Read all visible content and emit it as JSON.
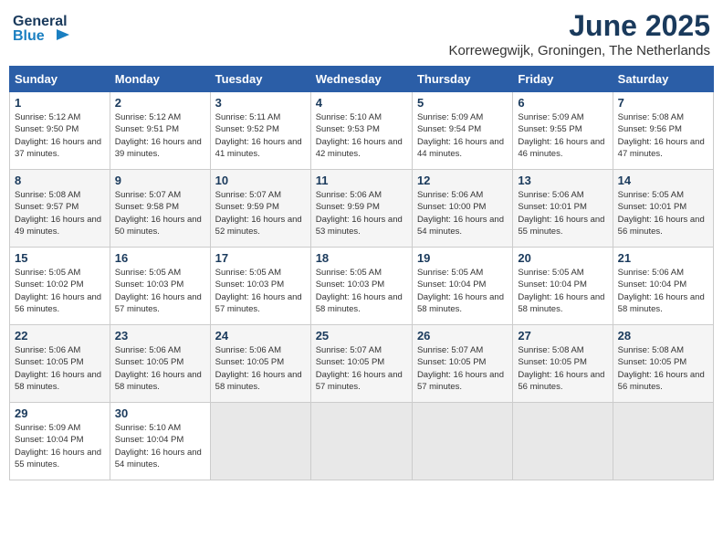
{
  "header": {
    "logo_line1": "General",
    "logo_line2": "Blue",
    "month": "June 2025",
    "location": "Korrewegwijk, Groningen, The Netherlands"
  },
  "weekdays": [
    "Sunday",
    "Monday",
    "Tuesday",
    "Wednesday",
    "Thursday",
    "Friday",
    "Saturday"
  ],
  "weeks": [
    [
      {
        "day": "1",
        "sunrise": "Sunrise: 5:12 AM",
        "sunset": "Sunset: 9:50 PM",
        "daylight": "Daylight: 16 hours and 37 minutes."
      },
      {
        "day": "2",
        "sunrise": "Sunrise: 5:12 AM",
        "sunset": "Sunset: 9:51 PM",
        "daylight": "Daylight: 16 hours and 39 minutes."
      },
      {
        "day": "3",
        "sunrise": "Sunrise: 5:11 AM",
        "sunset": "Sunset: 9:52 PM",
        "daylight": "Daylight: 16 hours and 41 minutes."
      },
      {
        "day": "4",
        "sunrise": "Sunrise: 5:10 AM",
        "sunset": "Sunset: 9:53 PM",
        "daylight": "Daylight: 16 hours and 42 minutes."
      },
      {
        "day": "5",
        "sunrise": "Sunrise: 5:09 AM",
        "sunset": "Sunset: 9:54 PM",
        "daylight": "Daylight: 16 hours and 44 minutes."
      },
      {
        "day": "6",
        "sunrise": "Sunrise: 5:09 AM",
        "sunset": "Sunset: 9:55 PM",
        "daylight": "Daylight: 16 hours and 46 minutes."
      },
      {
        "day": "7",
        "sunrise": "Sunrise: 5:08 AM",
        "sunset": "Sunset: 9:56 PM",
        "daylight": "Daylight: 16 hours and 47 minutes."
      }
    ],
    [
      {
        "day": "8",
        "sunrise": "Sunrise: 5:08 AM",
        "sunset": "Sunset: 9:57 PM",
        "daylight": "Daylight: 16 hours and 49 minutes."
      },
      {
        "day": "9",
        "sunrise": "Sunrise: 5:07 AM",
        "sunset": "Sunset: 9:58 PM",
        "daylight": "Daylight: 16 hours and 50 minutes."
      },
      {
        "day": "10",
        "sunrise": "Sunrise: 5:07 AM",
        "sunset": "Sunset: 9:59 PM",
        "daylight": "Daylight: 16 hours and 52 minutes."
      },
      {
        "day": "11",
        "sunrise": "Sunrise: 5:06 AM",
        "sunset": "Sunset: 9:59 PM",
        "daylight": "Daylight: 16 hours and 53 minutes."
      },
      {
        "day": "12",
        "sunrise": "Sunrise: 5:06 AM",
        "sunset": "Sunset: 10:00 PM",
        "daylight": "Daylight: 16 hours and 54 minutes."
      },
      {
        "day": "13",
        "sunrise": "Sunrise: 5:06 AM",
        "sunset": "Sunset: 10:01 PM",
        "daylight": "Daylight: 16 hours and 55 minutes."
      },
      {
        "day": "14",
        "sunrise": "Sunrise: 5:05 AM",
        "sunset": "Sunset: 10:01 PM",
        "daylight": "Daylight: 16 hours and 56 minutes."
      }
    ],
    [
      {
        "day": "15",
        "sunrise": "Sunrise: 5:05 AM",
        "sunset": "Sunset: 10:02 PM",
        "daylight": "Daylight: 16 hours and 56 minutes."
      },
      {
        "day": "16",
        "sunrise": "Sunrise: 5:05 AM",
        "sunset": "Sunset: 10:03 PM",
        "daylight": "Daylight: 16 hours and 57 minutes."
      },
      {
        "day": "17",
        "sunrise": "Sunrise: 5:05 AM",
        "sunset": "Sunset: 10:03 PM",
        "daylight": "Daylight: 16 hours and 57 minutes."
      },
      {
        "day": "18",
        "sunrise": "Sunrise: 5:05 AM",
        "sunset": "Sunset: 10:03 PM",
        "daylight": "Daylight: 16 hours and 58 minutes."
      },
      {
        "day": "19",
        "sunrise": "Sunrise: 5:05 AM",
        "sunset": "Sunset: 10:04 PM",
        "daylight": "Daylight: 16 hours and 58 minutes."
      },
      {
        "day": "20",
        "sunrise": "Sunrise: 5:05 AM",
        "sunset": "Sunset: 10:04 PM",
        "daylight": "Daylight: 16 hours and 58 minutes."
      },
      {
        "day": "21",
        "sunrise": "Sunrise: 5:06 AM",
        "sunset": "Sunset: 10:04 PM",
        "daylight": "Daylight: 16 hours and 58 minutes."
      }
    ],
    [
      {
        "day": "22",
        "sunrise": "Sunrise: 5:06 AM",
        "sunset": "Sunset: 10:05 PM",
        "daylight": "Daylight: 16 hours and 58 minutes."
      },
      {
        "day": "23",
        "sunrise": "Sunrise: 5:06 AM",
        "sunset": "Sunset: 10:05 PM",
        "daylight": "Daylight: 16 hours and 58 minutes."
      },
      {
        "day": "24",
        "sunrise": "Sunrise: 5:06 AM",
        "sunset": "Sunset: 10:05 PM",
        "daylight": "Daylight: 16 hours and 58 minutes."
      },
      {
        "day": "25",
        "sunrise": "Sunrise: 5:07 AM",
        "sunset": "Sunset: 10:05 PM",
        "daylight": "Daylight: 16 hours and 57 minutes."
      },
      {
        "day": "26",
        "sunrise": "Sunrise: 5:07 AM",
        "sunset": "Sunset: 10:05 PM",
        "daylight": "Daylight: 16 hours and 57 minutes."
      },
      {
        "day": "27",
        "sunrise": "Sunrise: 5:08 AM",
        "sunset": "Sunset: 10:05 PM",
        "daylight": "Daylight: 16 hours and 56 minutes."
      },
      {
        "day": "28",
        "sunrise": "Sunrise: 5:08 AM",
        "sunset": "Sunset: 10:05 PM",
        "daylight": "Daylight: 16 hours and 56 minutes."
      }
    ],
    [
      {
        "day": "29",
        "sunrise": "Sunrise: 5:09 AM",
        "sunset": "Sunset: 10:04 PM",
        "daylight": "Daylight: 16 hours and 55 minutes."
      },
      {
        "day": "30",
        "sunrise": "Sunrise: 5:10 AM",
        "sunset": "Sunset: 10:04 PM",
        "daylight": "Daylight: 16 hours and 54 minutes."
      },
      null,
      null,
      null,
      null,
      null
    ]
  ]
}
